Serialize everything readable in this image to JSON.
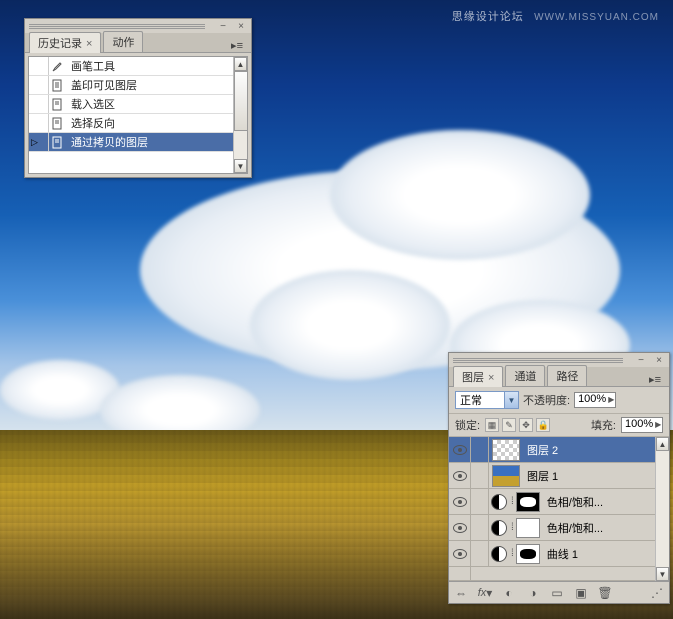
{
  "watermark": {
    "text": "思缘设计论坛",
    "url": "WWW.MISSYUAN.COM"
  },
  "history_panel": {
    "tabs": [
      {
        "label": "历史记录",
        "active": true
      },
      {
        "label": "动作",
        "active": false
      }
    ],
    "items": [
      {
        "icon": "brush",
        "label": "画笔工具"
      },
      {
        "icon": "stamp",
        "label": "盖印可见图层"
      },
      {
        "icon": "load",
        "label": "载入选区"
      },
      {
        "icon": "inverse",
        "label": "选择反向"
      },
      {
        "icon": "layer-copy",
        "label": "通过拷贝的图层",
        "selected": true,
        "pointer": true
      }
    ]
  },
  "layers_panel": {
    "tabs": [
      {
        "label": "图层",
        "active": true
      },
      {
        "label": "通道",
        "active": false
      },
      {
        "label": "路径",
        "active": false
      }
    ],
    "blend_mode": "正常",
    "opacity_label": "不透明度:",
    "opacity_value": "100%",
    "lock_label": "锁定:",
    "fill_label": "填充:",
    "fill_value": "100%",
    "layers": [
      {
        "name": "图层 2",
        "thumb": "checker",
        "selected": true,
        "eye": true
      },
      {
        "name": "图层 1",
        "thumb": "image",
        "eye": true
      },
      {
        "name": "色相/饱和...",
        "thumb": "adjust",
        "mask": "blob",
        "eye": true
      },
      {
        "name": "色相/饱和...",
        "thumb": "adjust",
        "mask": "white",
        "eye": true
      },
      {
        "name": "曲线 1",
        "thumb": "adjust",
        "mask": "blob-inv",
        "eye": true
      }
    ]
  }
}
